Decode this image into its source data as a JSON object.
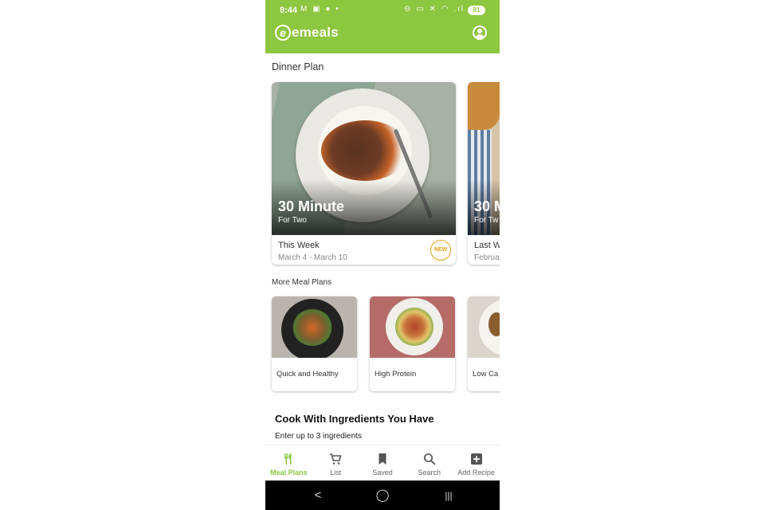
{
  "status_bar": {
    "time": "9:44",
    "left_icons": "M ▣ ● •",
    "right_icons": "⊖ ▭ ✕ ◠ .ıl",
    "battery": "81"
  },
  "header": {
    "brand": "emeals",
    "logo_letter": "e",
    "profile_icon": "account-circle-icon"
  },
  "dinner_plan": {
    "section_title": "Dinner Plan",
    "cards": [
      {
        "title": "30 Minute",
        "subtitle": "For Two",
        "week": "This Week",
        "dates": "March 4 - March 10",
        "badge": "NEW"
      },
      {
        "title": "30 M",
        "subtitle": "For Tw",
        "week": "Last W",
        "dates": "Februa"
      }
    ]
  },
  "more_meal_plans": {
    "section_title": "More Meal Plans",
    "items": [
      {
        "label": "Quick and Healthy"
      },
      {
        "label": "High Protein"
      },
      {
        "label": "Low Ca"
      }
    ]
  },
  "cook_with": {
    "title": "Cook With Ingredients You Have",
    "subtitle": "Enter up to 3 ingredients"
  },
  "tabs": [
    {
      "label": "Meal Plans",
      "icon": "fork-knife-icon",
      "active": true
    },
    {
      "label": "List",
      "icon": "cart-icon"
    },
    {
      "label": "Saved",
      "icon": "bookmark-icon"
    },
    {
      "label": "Search",
      "icon": "search-icon"
    },
    {
      "label": "Add Recipe",
      "icon": "plus-box-icon"
    }
  ],
  "nav": {
    "back": "<",
    "home": "◯",
    "recents": "|||"
  },
  "colors": {
    "brand_green": "#8dc63f",
    "badge_gold": "#e4a11b"
  }
}
